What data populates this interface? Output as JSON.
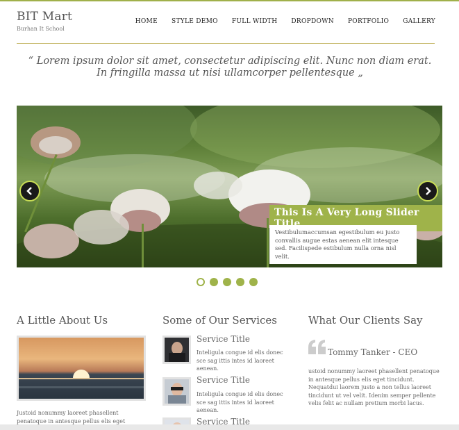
{
  "brand": {
    "title": "BIT Mart",
    "subtitle": "Burhan It School"
  },
  "nav": [
    "HOME",
    "STYLE DEMO",
    "FULL WIDTH",
    "DROPDOWN",
    "PORTFOLIO",
    "GALLERY"
  ],
  "quote": "“ Lorem ipsum dolor sit amet, consectetur adipiscing elit. Nunc non diam erat. In fringilla massa ut nisi ullamcorper pellentesque „",
  "slider": {
    "caption_title": "This Is A Very Long Slider Title",
    "caption_text": "Vestibulumaccumsan egestibulum eu justo convallis augue estas aenean elit intesque sed. Facilispede estibulum nulla orna nisl velit.",
    "slide_count": 5,
    "active_slide": 1
  },
  "about": {
    "title": "A Little About Us",
    "text": "Justoid nonummy laoreet phasellent penatoque in antesque pellus elis eget tincidunt. Nequatdui"
  },
  "services": {
    "title": "Some of Our Services",
    "items": [
      {
        "title": "Service Title",
        "text": "Inteligula congue id elis donec sce sag ittis intes id laoreet aenean."
      },
      {
        "title": "Service Title",
        "text": "Inteligula congue id elis donec sce sag ittis intes id laoreet aenean."
      },
      {
        "title": "Service Title",
        "text": ""
      }
    ]
  },
  "clients": {
    "title": "What Our Clients Say",
    "name": "Tommy Tanker - CEO",
    "text": "ustoid nonummy laoreet phasellent penatoque in antesque pellus elis eget tincidunt. Nequatdui laorem justo a non tellus laoreet tincidunt ut vel velit. Idenim semper pellente velis felit ac nullam pretium morbi lacus."
  },
  "colors": {
    "accent": "#9fb34a",
    "rule": "#c6b86a",
    "text": "#555555"
  }
}
